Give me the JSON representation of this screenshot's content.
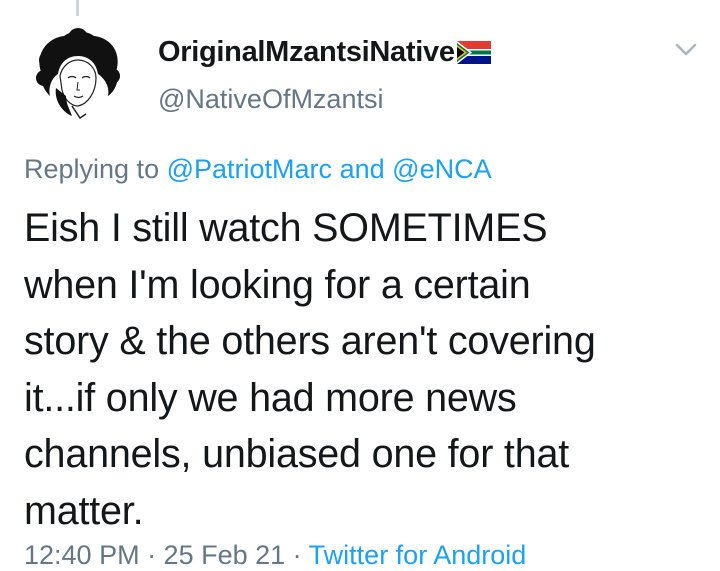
{
  "tweet": {
    "display_name": "OriginalMzantsiNative",
    "handle": "@NativeOfMzantsi",
    "reply_prefix": "Replying to",
    "reply_mentions": [
      "@PatriotMarc",
      "@eNCA"
    ],
    "reply_joiner": "and",
    "text_lines": [
      "Eish I still watch SOMETIMES",
      "when I'm looking for a certain",
      "story & the others aren't covering",
      "it...if only we had more news",
      "channels, unbiased one for that",
      "matter."
    ],
    "footer_time": "12:40 PM · 25 Feb 21 ·",
    "footer_source": "Twitter for Android"
  },
  "icons": {
    "avatar": "afro-woman-illustration",
    "flag": "south-africa-flag-icon",
    "menu": "chevron-down-icon"
  },
  "colors": {
    "text": "#14171a",
    "secondary": "#657786",
    "link": "#1da1f2"
  }
}
